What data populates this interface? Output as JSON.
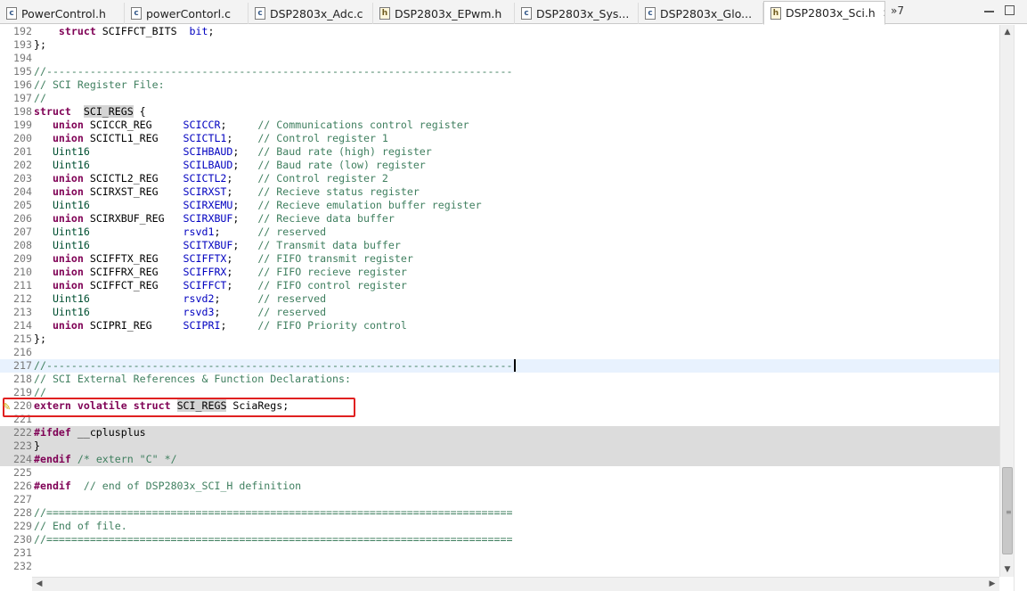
{
  "tabs": [
    {
      "label": "PowerControl.h",
      "icon": "c-file-icon",
      "glyph": "c"
    },
    {
      "label": "powerContorl.c",
      "icon": "c-file-icon",
      "glyph": "c"
    },
    {
      "label": "DSP2803x_Adc.c",
      "icon": "c-file-icon",
      "glyph": "c"
    },
    {
      "label": "DSP2803x_EPwm.h",
      "icon": "h-file-icon",
      "glyph": "h"
    },
    {
      "label": "DSP2803x_Sys...",
      "icon": "c-file-icon",
      "glyph": "c"
    },
    {
      "label": "DSP2803x_Glo...",
      "icon": "c-file-icon",
      "glyph": "c"
    },
    {
      "label": "DSP2803x_Sci.h",
      "icon": "h-file-icon",
      "glyph": "h",
      "active": true
    }
  ],
  "tab_close_glyph": "✕",
  "overflow_label": "»7",
  "scroll_glyphs": {
    "up": "▲",
    "down": "▼",
    "left": "◀",
    "right": "▶",
    "grip": "≡"
  },
  "marker_glyph": "✎",
  "lines": [
    {
      "n": "192",
      "tokens": [
        {
          "t": "    "
        },
        {
          "t": "struct",
          "c": "kw"
        },
        {
          "t": " SCIFFCT_BITS  "
        },
        {
          "t": "bit",
          "c": "fld"
        },
        {
          "t": ";"
        }
      ]
    },
    {
      "n": "193",
      "tokens": [
        {
          "t": "};"
        }
      ]
    },
    {
      "n": "194",
      "tokens": []
    },
    {
      "n": "195",
      "tokens": [
        {
          "t": "//---------------------------------------------------------------------------",
          "c": "cm"
        }
      ]
    },
    {
      "n": "196",
      "tokens": [
        {
          "t": "// SCI Register File:",
          "c": "cm"
        }
      ]
    },
    {
      "n": "197",
      "tokens": [
        {
          "t": "//",
          "c": "cm"
        }
      ]
    },
    {
      "n": "198",
      "tokens": [
        {
          "t": "struct",
          "c": "kw"
        },
        {
          "t": "  "
        },
        {
          "t": "SCI_REGS",
          "c": "hl"
        },
        {
          "t": " {"
        }
      ]
    },
    {
      "n": "199",
      "tokens": [
        {
          "t": "   "
        },
        {
          "t": "union",
          "c": "kw"
        },
        {
          "t": " SCICCR_REG     "
        },
        {
          "t": "SCICCR",
          "c": "fld"
        },
        {
          "t": ";     "
        },
        {
          "t": "// Communications control register",
          "c": "cm"
        }
      ]
    },
    {
      "n": "200",
      "tokens": [
        {
          "t": "   "
        },
        {
          "t": "union",
          "c": "kw"
        },
        {
          "t": " SCICTL1_REG    "
        },
        {
          "t": "SCICTL1",
          "c": "fld"
        },
        {
          "t": ";    "
        },
        {
          "t": "// Control register 1",
          "c": "cm"
        }
      ]
    },
    {
      "n": "201",
      "tokens": [
        {
          "t": "   "
        },
        {
          "t": "Uint16",
          "c": "typ"
        },
        {
          "t": "               "
        },
        {
          "t": "SCIHBAUD",
          "c": "fld"
        },
        {
          "t": ";   "
        },
        {
          "t": "// Baud rate (high) register",
          "c": "cm"
        }
      ]
    },
    {
      "n": "202",
      "tokens": [
        {
          "t": "   "
        },
        {
          "t": "Uint16",
          "c": "typ"
        },
        {
          "t": "               "
        },
        {
          "t": "SCILBAUD",
          "c": "fld"
        },
        {
          "t": ";   "
        },
        {
          "t": "// Baud rate (low) register",
          "c": "cm"
        }
      ]
    },
    {
      "n": "203",
      "tokens": [
        {
          "t": "   "
        },
        {
          "t": "union",
          "c": "kw"
        },
        {
          "t": " SCICTL2_REG    "
        },
        {
          "t": "SCICTL2",
          "c": "fld"
        },
        {
          "t": ";    "
        },
        {
          "t": "// Control register 2",
          "c": "cm"
        }
      ]
    },
    {
      "n": "204",
      "tokens": [
        {
          "t": "   "
        },
        {
          "t": "union",
          "c": "kw"
        },
        {
          "t": " SCIRXST_REG    "
        },
        {
          "t": "SCIRXST",
          "c": "fld"
        },
        {
          "t": ";    "
        },
        {
          "t": "// Recieve status register",
          "c": "cm"
        }
      ]
    },
    {
      "n": "205",
      "tokens": [
        {
          "t": "   "
        },
        {
          "t": "Uint16",
          "c": "typ"
        },
        {
          "t": "               "
        },
        {
          "t": "SCIRXEMU",
          "c": "fld"
        },
        {
          "t": ";   "
        },
        {
          "t": "// Recieve emulation buffer register",
          "c": "cm"
        }
      ]
    },
    {
      "n": "206",
      "tokens": [
        {
          "t": "   "
        },
        {
          "t": "union",
          "c": "kw"
        },
        {
          "t": " SCIRXBUF_REG   "
        },
        {
          "t": "SCIRXBUF",
          "c": "fld"
        },
        {
          "t": ";   "
        },
        {
          "t": "// Recieve data buffer",
          "c": "cm"
        }
      ]
    },
    {
      "n": "207",
      "tokens": [
        {
          "t": "   "
        },
        {
          "t": "Uint16",
          "c": "typ"
        },
        {
          "t": "               "
        },
        {
          "t": "rsvd1",
          "c": "fld"
        },
        {
          "t": ";      "
        },
        {
          "t": "// reserved",
          "c": "cm"
        }
      ]
    },
    {
      "n": "208",
      "tokens": [
        {
          "t": "   "
        },
        {
          "t": "Uint16",
          "c": "typ"
        },
        {
          "t": "               "
        },
        {
          "t": "SCITXBUF",
          "c": "fld"
        },
        {
          "t": ";   "
        },
        {
          "t": "// Transmit data buffer",
          "c": "cm"
        }
      ]
    },
    {
      "n": "209",
      "tokens": [
        {
          "t": "   "
        },
        {
          "t": "union",
          "c": "kw"
        },
        {
          "t": " SCIFFTX_REG    "
        },
        {
          "t": "SCIFFTX",
          "c": "fld"
        },
        {
          "t": ";    "
        },
        {
          "t": "// FIFO transmit register",
          "c": "cm"
        }
      ]
    },
    {
      "n": "210",
      "tokens": [
        {
          "t": "   "
        },
        {
          "t": "union",
          "c": "kw"
        },
        {
          "t": " SCIFFRX_REG    "
        },
        {
          "t": "SCIFFRX",
          "c": "fld"
        },
        {
          "t": ";    "
        },
        {
          "t": "// FIFO recieve register",
          "c": "cm"
        }
      ]
    },
    {
      "n": "211",
      "tokens": [
        {
          "t": "   "
        },
        {
          "t": "union",
          "c": "kw"
        },
        {
          "t": " SCIFFCT_REG    "
        },
        {
          "t": "SCIFFCT",
          "c": "fld"
        },
        {
          "t": ";    "
        },
        {
          "t": "// FIFO control register",
          "c": "cm"
        }
      ]
    },
    {
      "n": "212",
      "tokens": [
        {
          "t": "   "
        },
        {
          "t": "Uint16",
          "c": "typ"
        },
        {
          "t": "               "
        },
        {
          "t": "rsvd2",
          "c": "fld"
        },
        {
          "t": ";      "
        },
        {
          "t": "// reserved",
          "c": "cm"
        }
      ]
    },
    {
      "n": "213",
      "tokens": [
        {
          "t": "   "
        },
        {
          "t": "Uint16",
          "c": "typ"
        },
        {
          "t": "               "
        },
        {
          "t": "rsvd3",
          "c": "fld"
        },
        {
          "t": ";      "
        },
        {
          "t": "// reserved",
          "c": "cm"
        }
      ]
    },
    {
      "n": "214",
      "tokens": [
        {
          "t": "   "
        },
        {
          "t": "union",
          "c": "kw"
        },
        {
          "t": " SCIPRI_REG     "
        },
        {
          "t": "SCIPRI",
          "c": "fld"
        },
        {
          "t": ";     "
        },
        {
          "t": "// FIFO Priority control",
          "c": "cm"
        }
      ]
    },
    {
      "n": "215",
      "tokens": [
        {
          "t": "};"
        }
      ]
    },
    {
      "n": "216",
      "tokens": []
    },
    {
      "n": "217",
      "tokens": [
        {
          "t": "//---------------------------------------------------------------------------",
          "c": "cm"
        }
      ],
      "current": true
    },
    {
      "n": "218",
      "tokens": [
        {
          "t": "// SCI External References & Function Declarations:",
          "c": "cm"
        }
      ]
    },
    {
      "n": "219",
      "tokens": [
        {
          "t": "//",
          "c": "cm"
        }
      ]
    },
    {
      "n": "220",
      "tokens": [
        {
          "t": "extern",
          "c": "kw"
        },
        {
          "t": " "
        },
        {
          "t": "volatile",
          "c": "kw"
        },
        {
          "t": " "
        },
        {
          "t": "struct",
          "c": "kw"
        },
        {
          "t": " "
        },
        {
          "t": "SCI_REGS",
          "c": "hl"
        },
        {
          "t": " SciaRegs;"
        }
      ]
    },
    {
      "n": "221",
      "tokens": []
    },
    {
      "n": "222",
      "tokens": [
        {
          "t": "#ifdef",
          "c": "kw"
        },
        {
          "t": " __cplusplus"
        }
      ],
      "gray": true
    },
    {
      "n": "223",
      "tokens": [
        {
          "t": "}"
        }
      ],
      "gray": true
    },
    {
      "n": "224",
      "tokens": [
        {
          "t": "#endif",
          "c": "kw"
        },
        {
          "t": " "
        },
        {
          "t": "/* extern \"C\" */",
          "c": "cm"
        }
      ],
      "gray": true
    },
    {
      "n": "225",
      "tokens": []
    },
    {
      "n": "226",
      "tokens": [
        {
          "t": "#endif",
          "c": "kw"
        },
        {
          "t": "  "
        },
        {
          "t": "// end of DSP2803x_SCI_H definition",
          "c": "cm"
        }
      ]
    },
    {
      "n": "227",
      "tokens": []
    },
    {
      "n": "228",
      "tokens": [
        {
          "t": "//===========================================================================",
          "c": "cm"
        }
      ]
    },
    {
      "n": "229",
      "tokens": [
        {
          "t": "// End of file.",
          "c": "cm"
        }
      ]
    },
    {
      "n": "230",
      "tokens": [
        {
          "t": "//===========================================================================",
          "c": "cm"
        }
      ]
    },
    {
      "n": "231",
      "tokens": []
    },
    {
      "n": "232",
      "tokens": []
    }
  ]
}
